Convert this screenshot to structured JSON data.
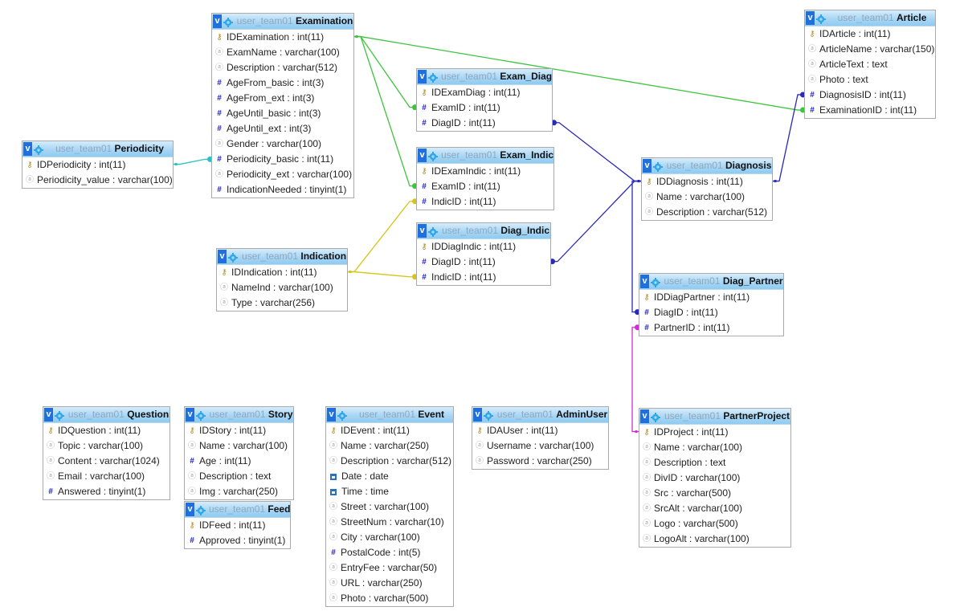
{
  "schema": "user_team01",
  "colors": {
    "link_green": "#3cc43c",
    "link_blue": "#2a2ab8",
    "link_yellow": "#d6c418",
    "link_cyan": "#28c0c8",
    "link_magenta": "#d030d0",
    "header_blue": "#a9d6f5",
    "toggle_blue": "#1f6fde"
  },
  "tables": [
    {
      "name": "Examination",
      "columns": [
        {
          "icon": "key",
          "text": "IDExamination : int(11)"
        },
        {
          "icon": "string",
          "text": "ExamName : varchar(100)"
        },
        {
          "icon": "string",
          "text": "Description : varchar(512)"
        },
        {
          "icon": "number",
          "text": "AgeFrom_basic : int(3)"
        },
        {
          "icon": "number",
          "text": "AgeFrom_ext : int(3)"
        },
        {
          "icon": "number",
          "text": "AgeUntil_basic : int(3)"
        },
        {
          "icon": "number",
          "text": "AgeUntil_ext : int(3)"
        },
        {
          "icon": "string",
          "text": "Gender : varchar(100)"
        },
        {
          "icon": "number",
          "text": "Periodicity_basic : int(11)"
        },
        {
          "icon": "string",
          "text": "Periodicity_ext : varchar(100)"
        },
        {
          "icon": "number",
          "text": "IndicationNeeded : tinyint(1)"
        }
      ]
    },
    {
      "name": "Periodicity",
      "columns": [
        {
          "icon": "key",
          "text": "IDPeriodicity : int(11)"
        },
        {
          "icon": "string",
          "text": "Periodicity_value : varchar(100)"
        }
      ]
    },
    {
      "name": "Exam_Diag",
      "columns": [
        {
          "icon": "key",
          "text": "IDExamDiag : int(11)"
        },
        {
          "icon": "number",
          "text": "ExamID : int(11)"
        },
        {
          "icon": "number",
          "text": "DiagID : int(11)"
        }
      ]
    },
    {
      "name": "Exam_Indic",
      "columns": [
        {
          "icon": "key",
          "text": "IDExamIndic : int(11)"
        },
        {
          "icon": "number",
          "text": "ExamID : int(11)"
        },
        {
          "icon": "number",
          "text": "IndicID : int(11)"
        }
      ]
    },
    {
      "name": "Diag_Indic",
      "columns": [
        {
          "icon": "key",
          "text": "IDDiagIndic : int(11)"
        },
        {
          "icon": "number",
          "text": "DiagID : int(11)"
        },
        {
          "icon": "number",
          "text": "IndicID : int(11)"
        }
      ]
    },
    {
      "name": "Article",
      "columns": [
        {
          "icon": "key",
          "text": "IDArticle : int(11)"
        },
        {
          "icon": "string",
          "text": "ArticleName : varchar(150)"
        },
        {
          "icon": "string",
          "text": "ArticleText : text"
        },
        {
          "icon": "string",
          "text": "Photo : text"
        },
        {
          "icon": "number",
          "text": "DiagnosisID : int(11)"
        },
        {
          "icon": "number",
          "text": "ExaminationID : int(11)"
        }
      ]
    },
    {
      "name": "Diagnosis",
      "columns": [
        {
          "icon": "key",
          "text": "IDDiagnosis : int(11)"
        },
        {
          "icon": "string",
          "text": "Name : varchar(100)"
        },
        {
          "icon": "string",
          "text": "Description : varchar(512)"
        }
      ]
    },
    {
      "name": "Indication",
      "columns": [
        {
          "icon": "key",
          "text": "IDIndication : int(11)"
        },
        {
          "icon": "string",
          "text": "NameInd : varchar(100)"
        },
        {
          "icon": "string",
          "text": "Type : varchar(256)"
        }
      ]
    },
    {
      "name": "Diag_Partner",
      "columns": [
        {
          "icon": "key",
          "text": "IDDiagPartner : int(11)"
        },
        {
          "icon": "number",
          "text": "DiagID : int(11)"
        },
        {
          "icon": "number",
          "text": "PartnerID : int(11)"
        }
      ]
    },
    {
      "name": "Question",
      "columns": [
        {
          "icon": "key",
          "text": "IDQuestion : int(11)"
        },
        {
          "icon": "string",
          "text": "Topic : varchar(100)"
        },
        {
          "icon": "string",
          "text": "Content : varchar(1024)"
        },
        {
          "icon": "string",
          "text": "Email : varchar(100)"
        },
        {
          "icon": "number",
          "text": "Answered : tinyint(1)"
        }
      ]
    },
    {
      "name": "Story",
      "columns": [
        {
          "icon": "key",
          "text": "IDStory : int(11)"
        },
        {
          "icon": "string",
          "text": "Name : varchar(100)"
        },
        {
          "icon": "number",
          "text": "Age : int(11)"
        },
        {
          "icon": "string",
          "text": "Description : text"
        },
        {
          "icon": "string",
          "text": "Img : varchar(250)"
        }
      ]
    },
    {
      "name": "Feed",
      "columns": [
        {
          "icon": "key",
          "text": "IDFeed : int(11)"
        },
        {
          "icon": "number",
          "text": "Approved : tinyint(1)"
        }
      ]
    },
    {
      "name": "Event",
      "columns": [
        {
          "icon": "key",
          "text": "IDEvent : int(11)"
        },
        {
          "icon": "string",
          "text": "Name : varchar(250)"
        },
        {
          "icon": "string",
          "text": "Description : varchar(512)"
        },
        {
          "icon": "date",
          "text": "Date : date"
        },
        {
          "icon": "date",
          "text": "Time : time"
        },
        {
          "icon": "string",
          "text": "Street : varchar(100)"
        },
        {
          "icon": "string",
          "text": "StreetNum : varchar(10)"
        },
        {
          "icon": "string",
          "text": "City : varchar(100)"
        },
        {
          "icon": "number",
          "text": "PostalCode : int(5)"
        },
        {
          "icon": "string",
          "text": "EntryFee : varchar(50)"
        },
        {
          "icon": "string",
          "text": "URL : varchar(250)"
        },
        {
          "icon": "string",
          "text": "Photo : varchar(500)"
        }
      ]
    },
    {
      "name": "AdminUser",
      "columns": [
        {
          "icon": "key",
          "text": "IDAUser : int(11)"
        },
        {
          "icon": "string",
          "text": "Username : varchar(100)"
        },
        {
          "icon": "string",
          "text": "Password : varchar(250)"
        }
      ]
    },
    {
      "name": "PartnerProject",
      "columns": [
        {
          "icon": "key",
          "text": "IDProject : int(11)"
        },
        {
          "icon": "string",
          "text": "Name : varchar(100)"
        },
        {
          "icon": "string",
          "text": "Description : text"
        },
        {
          "icon": "string",
          "text": "DivID : varchar(100)"
        },
        {
          "icon": "string",
          "text": "Src : varchar(500)"
        },
        {
          "icon": "string",
          "text": "SrcAlt : varchar(100)"
        },
        {
          "icon": "string",
          "text": "Logo : varchar(500)"
        },
        {
          "icon": "string",
          "text": "LogoAlt : varchar(100)"
        }
      ]
    }
  ],
  "relations": [
    {
      "from": "Exam_Diag.ExamID",
      "to": "Examination.IDExamination",
      "color": "link_green"
    },
    {
      "from": "Exam_Indic.ExamID",
      "to": "Examination.IDExamination",
      "color": "link_green"
    },
    {
      "from": "Article.ExaminationID",
      "to": "Examination.IDExamination",
      "color": "link_green"
    },
    {
      "from": "Examination.Periodicity_basic",
      "to": "Periodicity.IDPeriodicity",
      "color": "link_cyan"
    },
    {
      "from": "Exam_Indic.IndicID",
      "to": "Indication.IDIndication",
      "color": "link_yellow"
    },
    {
      "from": "Diag_Indic.IndicID",
      "to": "Indication.IDIndication",
      "color": "link_yellow"
    },
    {
      "from": "Exam_Diag.DiagID",
      "to": "Diagnosis.IDDiagnosis",
      "color": "link_blue"
    },
    {
      "from": "Diag_Indic.DiagID",
      "to": "Diagnosis.IDDiagnosis",
      "color": "link_blue"
    },
    {
      "from": "Diag_Partner.DiagID",
      "to": "Diagnosis.IDDiagnosis",
      "color": "link_blue"
    },
    {
      "from": "Article.DiagnosisID",
      "to": "Diagnosis.IDDiagnosis",
      "color": "link_blue"
    },
    {
      "from": "Diag_Partner.PartnerID",
      "to": "PartnerProject.IDProject",
      "color": "link_magenta"
    }
  ]
}
